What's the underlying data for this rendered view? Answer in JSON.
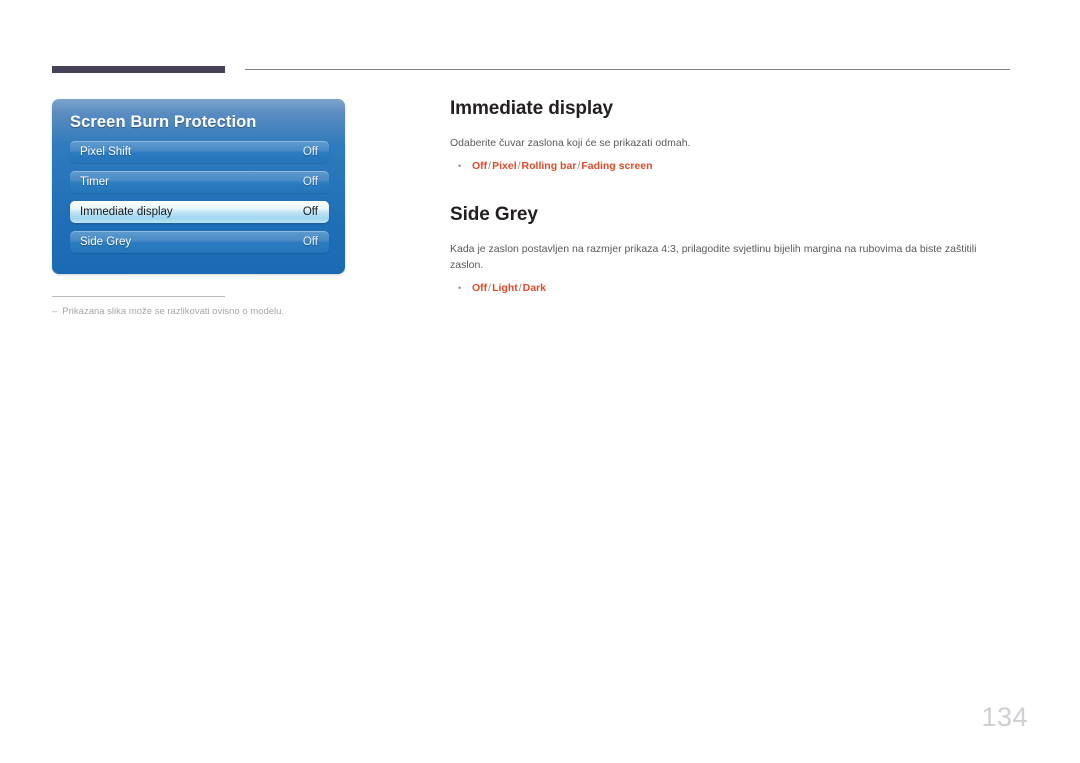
{
  "header": {
    "thick_rule": "",
    "thin_rule": ""
  },
  "osd": {
    "title": "Screen Burn Protection",
    "rows": [
      {
        "label": "Pixel Shift",
        "value": "Off",
        "selected": false
      },
      {
        "label": "Timer",
        "value": "Off",
        "selected": false
      },
      {
        "label": "Immediate display",
        "value": "Off",
        "selected": true
      },
      {
        "label": "Side Grey",
        "value": "Off",
        "selected": false
      }
    ]
  },
  "footnote": {
    "dash": "–",
    "text": "Prikazana slika može se razlikovati ovisno o modelu."
  },
  "sections": [
    {
      "heading": "Immediate display",
      "description": "Odaberite čuvar zaslona koji će se prikazati odmah.",
      "bullet": "•",
      "options": [
        "Off",
        "Pixel",
        "Rolling bar",
        "Fading screen"
      ],
      "separator": "/"
    },
    {
      "heading": "Side Grey",
      "description": "Kada je zaslon postavljen na razmjer prikaza 4:3, prilagodite svjetlinu bijelih margina na rubovima da biste zaštitili zaslon.",
      "bullet": "•",
      "options": [
        "Off",
        "Light",
        "Dark"
      ],
      "separator": "/"
    }
  ],
  "page_number": "134",
  "colors": {
    "accent_orange": "#e24a26",
    "panel_blue": "#1a69b4",
    "rule_dark": "#464154",
    "page_number_grey": "#cfcfd4"
  }
}
